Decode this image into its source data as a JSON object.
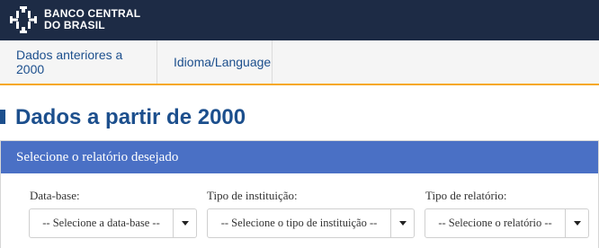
{
  "header": {
    "logo_line1": "BANCO CENTRAL",
    "logo_line2": "DO BRASIL"
  },
  "nav": {
    "items": [
      {
        "label": "Dados anteriores a 2000"
      },
      {
        "label": "Idioma/Language"
      }
    ]
  },
  "page": {
    "title": "Dados a partir de 2000"
  },
  "panel": {
    "heading": "Selecione o relatório desejado",
    "fields": [
      {
        "label": "Data-base:",
        "value": "-- Selecione a data-base --"
      },
      {
        "label": "Tipo de instituição:",
        "value": "-- Selecione o tipo de instituição --"
      },
      {
        "label": "Tipo de relatório:",
        "value": "-- Selecione o relatório --"
      }
    ]
  },
  "colors": {
    "topbar": "#1d2b45",
    "accent_blue": "#1c4f8d",
    "panel_header": "#4a70c5",
    "nav_underline": "#f6a81c"
  },
  "icons": {
    "logo": "bcb-logo-icon",
    "dropdown": "caret-down-icon"
  }
}
